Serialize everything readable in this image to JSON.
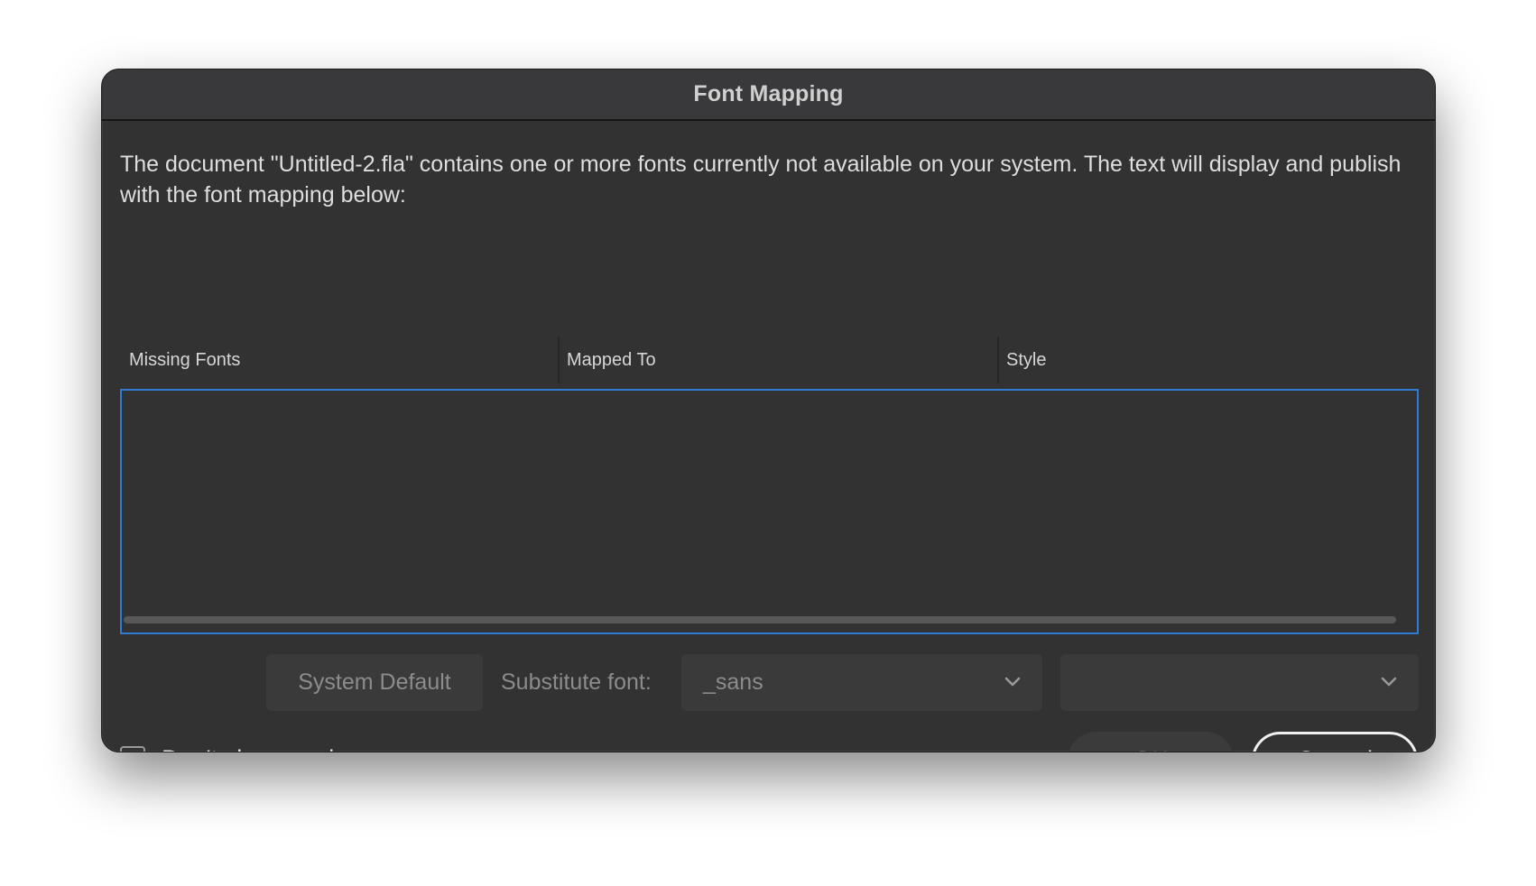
{
  "dialog": {
    "title": "Font Mapping",
    "message": "The document \"Untitled-2.fla\" contains one or more fonts currently not available on your system. The text will display and publish with the font mapping below:"
  },
  "table": {
    "columns": [
      "Missing Fonts",
      "Mapped To",
      "Style"
    ],
    "rows": []
  },
  "controls": {
    "system_default_label": "System Default",
    "substitute_label": "Substitute font:",
    "font_select_value": "_sans",
    "style_select_value": ""
  },
  "footer": {
    "dont_show_label": "Don't show again.",
    "dont_show_checked": false,
    "ok_label": "OK",
    "cancel_label": "Cancel"
  },
  "colors": {
    "dialog_bg": "#323232",
    "focus_border": "#2f7bd6",
    "disabled_text": "#8c8c8c"
  },
  "icons": {
    "select_arrow": "chevron-down-icon"
  }
}
